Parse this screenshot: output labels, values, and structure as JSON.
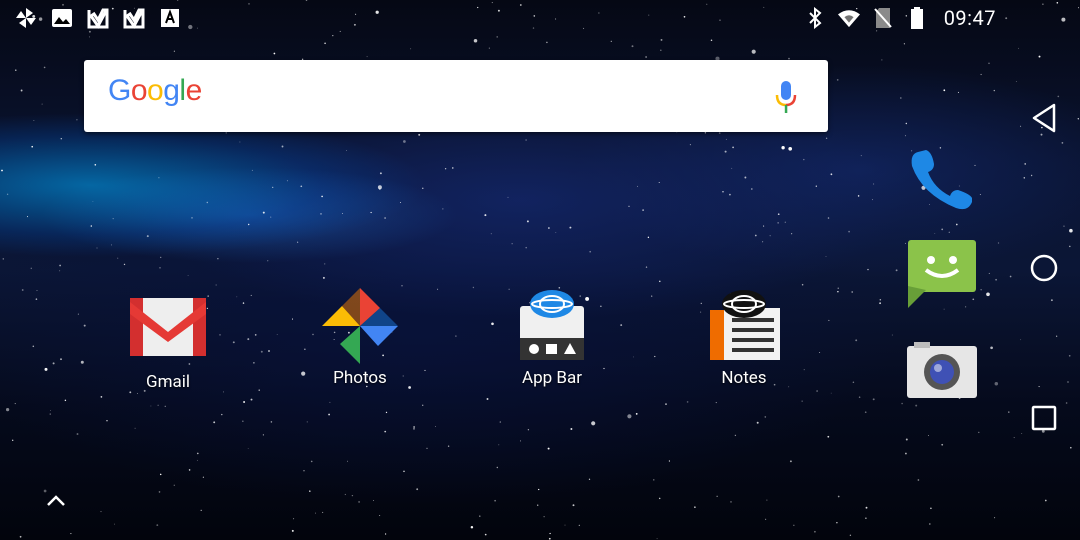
{
  "status_bar": {
    "left_icons": [
      "pinwheel-icon",
      "gallery-icon",
      "checkmark-app-icon",
      "checkmark-app-icon",
      "font-a-icon"
    ],
    "right_icons": [
      "bluetooth-icon",
      "wifi-icon",
      "no-sim-icon",
      "battery-icon"
    ],
    "time": "09:47"
  },
  "search": {
    "logo_letters": [
      {
        "char": "G",
        "color": "#4285F4"
      },
      {
        "char": "o",
        "color": "#EA4335"
      },
      {
        "char": "o",
        "color": "#FBBC05"
      },
      {
        "char": "g",
        "color": "#4285F4"
      },
      {
        "char": "l",
        "color": "#34A853"
      },
      {
        "char": "e",
        "color": "#EA4335"
      }
    ],
    "mic_icon": "microphone-icon"
  },
  "home_apps": [
    {
      "label": "Gmail",
      "icon": "gmail-icon"
    },
    {
      "label": "Photos",
      "icon": "photos-pinwheel-icon"
    },
    {
      "label": "App Bar",
      "icon": "app-bar-icon"
    },
    {
      "label": "Notes",
      "icon": "notes-icon"
    }
  ],
  "dock": [
    {
      "icon": "phone-icon",
      "color": "#1E88E5"
    },
    {
      "icon": "messaging-icon",
      "color": "#8BC34A"
    },
    {
      "icon": "camera-icon",
      "color": "#E0E0E0"
    }
  ],
  "navigation": [
    "back-icon",
    "home-icon",
    "recents-icon"
  ],
  "app_drawer_icon": "chevron-up-icon"
}
